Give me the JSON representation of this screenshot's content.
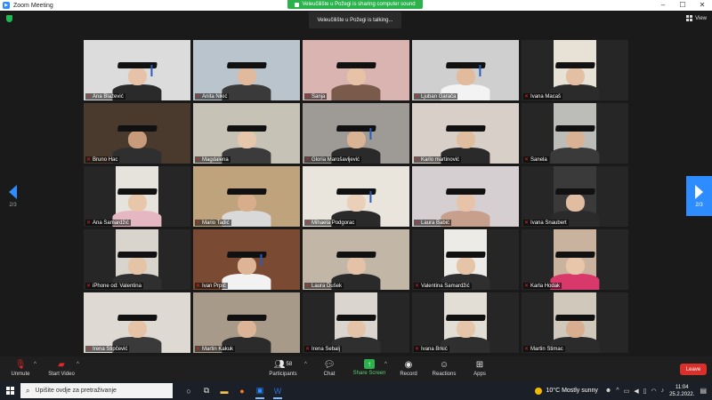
{
  "window": {
    "title": "Zoom Meeting",
    "controls": [
      "–",
      "☐",
      "✕"
    ]
  },
  "share_banner": "Veleučilište u Požegi is sharing computer sound",
  "talking": "Veleučilište u Požegi is talking...",
  "view_label": "View",
  "nav": {
    "left_page": "2/3",
    "right_page": "2/3"
  },
  "participants_grid": [
    {
      "name": "Ana Blažević",
      "bg": "#dcdcdc",
      "skin": "#e6c3a8",
      "shirt": "#2a2a2a",
      "tassel": true
    },
    {
      "name": "Anita Nikić",
      "bg": "#b9c4cc",
      "skin": "#e1b99c",
      "shirt": "#3a3a3a",
      "tassel": false
    },
    {
      "name": "Sanja",
      "bg": "#d9b4b0",
      "skin": "#e8c2a6",
      "shirt": "#7a5a4a",
      "tassel": false
    },
    {
      "name": "Ljuban Garača",
      "bg": "#cfcfcf",
      "skin": "#e2bb9c",
      "shirt": "#f3f3f3",
      "tassel": true
    },
    {
      "name": "Ivana Macaš",
      "bg": "#e8e2d6",
      "skin": "#e3c0a4",
      "shirt": "#2b2b2b",
      "tassel": false
    },
    {
      "name": "Bruno Hac",
      "bg": "#4a3a2e",
      "skin": "#c89b7a",
      "shirt": "#2f2f2f",
      "tassel": false
    },
    {
      "name": "Magdalena",
      "bg": "#c7c2b6",
      "skin": "#e6c7ab",
      "shirt": "#3b3b3b",
      "tassel": false
    },
    {
      "name": "Gloria Marošavljević",
      "bg": "#9e9a95",
      "skin": "#d8b394",
      "shirt": "#2a2a2a",
      "tassel": true
    },
    {
      "name": "Karlo martinović",
      "bg": "#d8cfc8",
      "skin": "#e1bda0",
      "shirt": "#2a2a2a",
      "tassel": false
    },
    {
      "name": "Sanela",
      "bg": "#bcbcb8",
      "skin": "#d9b194",
      "shirt": "#3a3a3a",
      "tassel": false
    },
    {
      "name": "Ana Samardžić",
      "bg": "#e6e3dd",
      "skin": "#e8c6aa",
      "shirt": "#e5b7c2",
      "tassel": false
    },
    {
      "name": "Mario Tadić",
      "bg": "#bfa37c",
      "skin": "#d8ad8c",
      "shirt": "#d9d9d9",
      "tassel": false
    },
    {
      "name": "Mihaela Podgorac",
      "bg": "#e9e4dc",
      "skin": "#ead0b8",
      "shirt": "#2a2a2a",
      "tassel": true
    },
    {
      "name": "Laura Babić",
      "bg": "#d6cfd2",
      "skin": "#e7c4a9",
      "shirt": "#c7a08d",
      "tassel": false
    },
    {
      "name": "Ivana Šnaubert",
      "bg": "#3a3a3a",
      "skin": "#e0bca0",
      "shirt": "#2b2b2b",
      "tassel": false
    },
    {
      "name": "iPhone od: Valentina",
      "bg": "#d9d4cc",
      "skin": "#e4c3a6",
      "shirt": "#2f2f2f",
      "tassel": false
    },
    {
      "name": "Ivan Prpić",
      "bg": "#7b4a33",
      "skin": "#deb496",
      "shirt": "#f2f2f2",
      "tassel": true
    },
    {
      "name": "Laura Dušek",
      "bg": "#c2b7a6",
      "skin": "#e3c2a7",
      "shirt": "#2a2a2a",
      "tassel": false
    },
    {
      "name": "Valentina Samardžić",
      "bg": "#ecebe8",
      "skin": "#e6c4a8",
      "shirt": "#2f2f2f",
      "tassel": false
    },
    {
      "name": "Karla Hodak",
      "bg": "#c9b39f",
      "skin": "#e8c6aa",
      "shirt": "#d8386a",
      "tassel": false
    },
    {
      "name": "Irena Stipčević",
      "bg": "#dedad3",
      "skin": "#e6c3a7",
      "shirt": "#3a3a3a",
      "tassel": false
    },
    {
      "name": "Martin Kakuk",
      "bg": "#a89a88",
      "skin": "#dcb596",
      "shirt": "#2b2b2b",
      "tassel": false
    },
    {
      "name": "Irena Šebalj",
      "bg": "#dad6cf",
      "skin": "#e4c4a9",
      "shirt": "#2f2f2f",
      "tassel": false
    },
    {
      "name": "Ivana Brkić",
      "bg": "#e2ddd5",
      "skin": "#e6c6ab",
      "shirt": "#2f2f2f",
      "tassel": false
    },
    {
      "name": "Martin Štimac",
      "bg": "#cfc8bb",
      "skin": "#d7af90",
      "shirt": "#2b2b2b",
      "tassel": false
    }
  ],
  "toolbar": {
    "unmute": "Unmute",
    "start_video": "Start Video",
    "participants": "Participants",
    "participants_count": "58",
    "chat": "Chat",
    "share_screen": "Share Screen",
    "record": "Record",
    "reactions": "Reactions",
    "apps": "Apps",
    "leave": "Leave"
  },
  "taskbar": {
    "search_placeholder": "Upišite ovdje za pretraživanje",
    "weather": "10°C Mostly sunny",
    "time": "11:04",
    "date": "25.2.2022."
  },
  "colors": {
    "zoom_blue": "#2d8cff",
    "share_green": "#2bb24c",
    "leave_red": "#d9302c"
  }
}
